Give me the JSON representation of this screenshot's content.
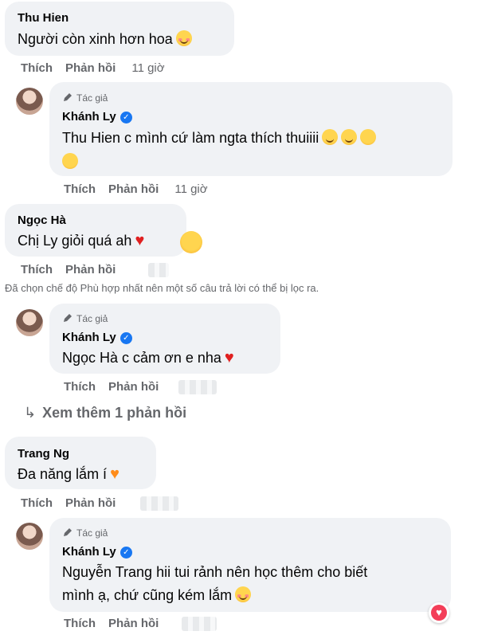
{
  "comments": [
    {
      "name": "Thu Hien",
      "text": "Người còn xinh hơn hoa",
      "emojis": [
        "smiling-blush-emoji"
      ],
      "actions": {
        "like": "Thích",
        "reply": "Phản hồi",
        "time": "11 giờ"
      }
    },
    {
      "author_tag": "Tác giả",
      "name": "Khánh Ly",
      "text_line1": "Thu Hien c mình cứ làm ngta thích thuiiii",
      "emojis": [
        "grin-emoji",
        "grin-emoji",
        "kiss-emoji",
        "kiss-emoji"
      ],
      "actions": {
        "like": "Thích",
        "reply": "Phản hồi",
        "time": "11 giờ"
      }
    },
    {
      "name": "Ngọc Hà",
      "text": "Chị Ly giỏi quá ah",
      "emojis": [
        "red-heart-emoji",
        "hearts-face-emoji"
      ],
      "actions": {
        "like": "Thích",
        "reply": "Phản hồi"
      }
    },
    {
      "author_tag": "Tác giả",
      "name": "Khánh Ly",
      "text": "Ngọc Hà c cảm ơn e nha",
      "emojis": [
        "red-heart-emoji"
      ],
      "actions": {
        "like": "Thích",
        "reply": "Phản hồi"
      }
    },
    {
      "name": "Trang Ng",
      "text": "Đa năng lắm í",
      "emojis": [
        "orange-heart-emoji"
      ],
      "actions": {
        "like": "Thích",
        "reply": "Phản hồi"
      }
    },
    {
      "author_tag": "Tác giả",
      "name": "Khánh Ly",
      "text_line1": "Nguyễn Trang hii tui rảnh nên học thêm cho biết",
      "text_line2": "mình ạ, chứ cũng kém lắm",
      "emojis": [
        "smiling-blush-emoji"
      ],
      "actions": {
        "like": "Thích",
        "reply": "Phản hồi"
      }
    }
  ],
  "filter_notice": "Đã chọn chế độ Phù hợp nhất nên một số câu trả lời có thể bị lọc ra.",
  "more_replies": "Xem thêm 1 phản hồi",
  "colors": {
    "bubble": "#f0f2f5",
    "verified": "#1877f2",
    "muted": "#65676b",
    "love_reaction": "#f33e58"
  }
}
